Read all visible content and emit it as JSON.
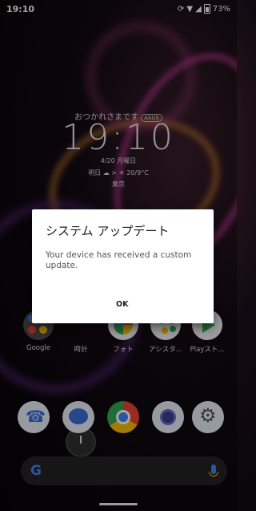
{
  "status_bar": {
    "time": "19:10",
    "battery": "73%"
  },
  "lockscreen": {
    "greeting": "おつかれさまです",
    "greeting_tag": "ASUS",
    "clock": "19:10",
    "date": "4/20 月曜日",
    "weather": "明日 ☁ > ☀ 20/9°C",
    "location": "東京"
  },
  "dialog": {
    "title": "システム アップデート",
    "message": "Your device has received a custom update.",
    "ok_label": "OK"
  },
  "apps": [
    {
      "label": "Google",
      "icon": "google-icon"
    },
    {
      "label": "時計",
      "icon": "clock-icon"
    },
    {
      "label": "フォト",
      "icon": "photos-icon"
    },
    {
      "label": "アシスタ...",
      "icon": "assistant-icon"
    },
    {
      "label": "Playスト...",
      "icon": "play-store-icon"
    }
  ],
  "dock": [
    "phone-icon",
    "messages-icon",
    "chrome-icon",
    "camera-icon",
    "settings-icon"
  ],
  "search": {
    "logo": "G"
  }
}
